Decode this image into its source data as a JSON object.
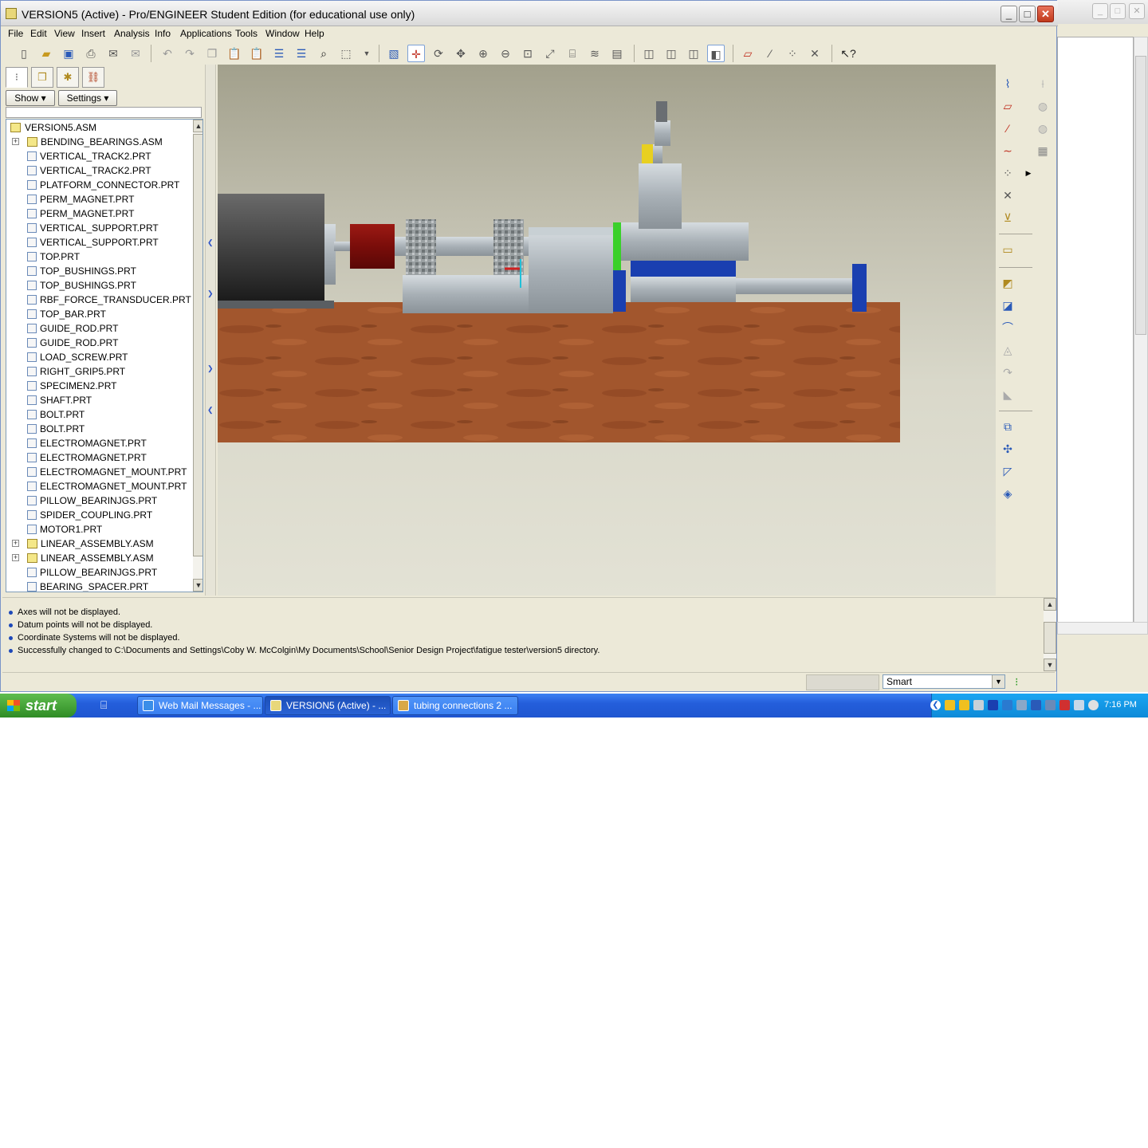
{
  "window": {
    "title": "VERSION5 (Active) - Pro/ENGINEER Student Edition (for educational use only)",
    "minimize": "_",
    "maximize": "□",
    "close": "✕"
  },
  "menubar": [
    "File",
    "Edit",
    "View",
    "Insert",
    "Analysis",
    "Info",
    "Applications",
    "Tools",
    "Window",
    "Help"
  ],
  "toolbar": {
    "icons": [
      "new-icon",
      "open-icon",
      "save-icon",
      "print-icon",
      "email-icon",
      "email-link-icon",
      "undo-icon",
      "redo-icon",
      "copy-icon",
      "paste-icon",
      "paste-special-icon",
      "regenerate-icon",
      "regen-manager-icon",
      "find-icon",
      "select-box-icon",
      "select-dropdown-icon",
      "repaint-icon",
      "spin-center-icon",
      "orient-mode-icon",
      "pan-icon",
      "zoom-in-icon",
      "zoom-out-icon",
      "refit-icon",
      "reorient-icon",
      "saved-views-icon",
      "layers-icon",
      "view-manager-icon",
      "wireframe-icon",
      "hidden-line-icon",
      "no-hidden-icon",
      "shading-icon",
      "datum-planes-icon",
      "datum-axes-icon",
      "datum-points-icon",
      "coord-sys-icon",
      "context-help-icon"
    ],
    "shading_active": true
  },
  "panel": {
    "tabs": [
      "model-tree-tab",
      "folder-browser-tab",
      "favorites-tab",
      "connections-tab"
    ],
    "show_label": "Show",
    "settings_label": "Settings",
    "tree": [
      {
        "label": "VERSION5.ASM",
        "type": "root"
      },
      {
        "label": "BENDING_BEARINGS.ASM",
        "type": "asm",
        "expand": true
      },
      {
        "label": "VERTICAL_TRACK2.PRT",
        "type": "prt"
      },
      {
        "label": "VERTICAL_TRACK2.PRT",
        "type": "prt"
      },
      {
        "label": "PLATFORM_CONNECTOR.PRT",
        "type": "prt"
      },
      {
        "label": "PERM_MAGNET.PRT",
        "type": "prt"
      },
      {
        "label": "PERM_MAGNET.PRT",
        "type": "prt"
      },
      {
        "label": "VERTICAL_SUPPORT.PRT",
        "type": "prt"
      },
      {
        "label": "VERTICAL_SUPPORT.PRT",
        "type": "prt"
      },
      {
        "label": "TOP.PRT",
        "type": "prt"
      },
      {
        "label": "TOP_BUSHINGS.PRT",
        "type": "prt"
      },
      {
        "label": "TOP_BUSHINGS.PRT",
        "type": "prt"
      },
      {
        "label": "RBF_FORCE_TRANSDUCER.PRT",
        "type": "prt"
      },
      {
        "label": "TOP_BAR.PRT",
        "type": "prt"
      },
      {
        "label": "GUIDE_ROD.PRT",
        "type": "prt"
      },
      {
        "label": "GUIDE_ROD.PRT",
        "type": "prt"
      },
      {
        "label": "LOAD_SCREW.PRT",
        "type": "prt"
      },
      {
        "label": "RIGHT_GRIP5.PRT",
        "type": "prt"
      },
      {
        "label": "SPECIMEN2.PRT",
        "type": "prt"
      },
      {
        "label": "SHAFT.PRT",
        "type": "prt"
      },
      {
        "label": "BOLT.PRT",
        "type": "prt"
      },
      {
        "label": "BOLT.PRT",
        "type": "prt"
      },
      {
        "label": "ELECTROMAGNET.PRT",
        "type": "prt"
      },
      {
        "label": "ELECTROMAGNET.PRT",
        "type": "prt"
      },
      {
        "label": "ELECTROMAGNET_MOUNT.PRT",
        "type": "prt"
      },
      {
        "label": "ELECTROMAGNET_MOUNT.PRT",
        "type": "prt"
      },
      {
        "label": "PILLOW_BEARINJGS.PRT",
        "type": "prt"
      },
      {
        "label": "SPIDER_COUPLING.PRT",
        "type": "prt"
      },
      {
        "label": "MOTOR1.PRT",
        "type": "prt"
      },
      {
        "label": "LINEAR_ASSEMBLY.ASM",
        "type": "asm",
        "expand": true
      },
      {
        "label": "LINEAR_ASSEMBLY.ASM",
        "type": "asm",
        "expand": true
      },
      {
        "label": "PILLOW_BEARINJGS.PRT",
        "type": "prt"
      },
      {
        "label": "BEARING_SPACER.PRT",
        "type": "prt"
      }
    ]
  },
  "rightbar": {
    "icons": [
      "sketch-tool-icon",
      "datum-plane-tool-icon",
      "datum-axis-tool-icon",
      "datum-curve-tool-icon",
      "datum-point-tool-icon",
      "coord-sys-tool-icon",
      "analysis-tool-icon",
      "annotation-icon",
      "hole-tool-icon",
      "shell-tool-icon",
      "rib-tool-icon",
      "draft-tool-icon",
      "round-tool-icon",
      "chamfer-tool-icon",
      "pattern-tool-icon",
      "mirror-tool-icon",
      "merge-tool-icon",
      "trim-tool-icon"
    ]
  },
  "messages": [
    "Axes will not be displayed.",
    "Datum points will not be displayed.",
    "Coordinate Systems will not be displayed.",
    "Successfully changed to C:\\Documents and Settings\\Coby W. McColgin\\My Documents\\School\\Senior Design Project\\fatigue tester\\version5 directory."
  ],
  "status": {
    "filter": "Smart"
  },
  "taskbar": {
    "start": "start",
    "tasks": [
      "Web Mail Messages - ...",
      "VERSION5 (Active) - ...",
      "tubing connections 2 ..."
    ],
    "clock": "7:16 PM"
  },
  "colors": {
    "wood": "#a0552e",
    "coupling_red": "#8b1010",
    "magnet_blue": "#1a3fb0",
    "grip_yellow": "#e8d020",
    "grip_green": "#3ad02a",
    "steel": "#b4bcc2"
  }
}
